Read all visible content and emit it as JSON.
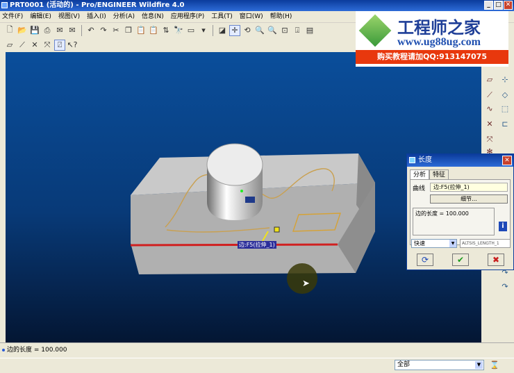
{
  "window": {
    "title": "PRT0001 (活动的) - Pro/ENGINEER Wildfire 4.0"
  },
  "menu": [
    "文件(F)",
    "编辑(E)",
    "视图(V)",
    "插入(I)",
    "分析(A)",
    "信息(N)",
    "应用程序(P)",
    "工具(T)",
    "窗口(W)",
    "帮助(H)"
  ],
  "logo": {
    "title": "工程师之家",
    "url": "www.ug88ug.com",
    "buy": "购买教程请加QQ:913147075"
  },
  "dialog": {
    "title": "长度",
    "tabs": [
      "分析",
      "特征"
    ],
    "curve_label": "曲线",
    "curve_value": "边:F5(拉伸_1)",
    "detail_label": "细节...",
    "result": "边的长度 = 100.000",
    "quick": "快速",
    "param_name": "ALTSIS_LENGTH_1",
    "btn_refresh": "⟳",
    "btn_ok": "✔",
    "btn_cancel": "✖"
  },
  "viewport": {
    "edge_tag": "边:F5(拉伸_1)"
  },
  "status": {
    "message": "边的长度 = 100.000"
  },
  "filter": {
    "value": "全部"
  },
  "colors": {
    "accent_red": "#d02020",
    "curve_orange": "#c9a050",
    "title_blue": "#0b3c9c"
  }
}
